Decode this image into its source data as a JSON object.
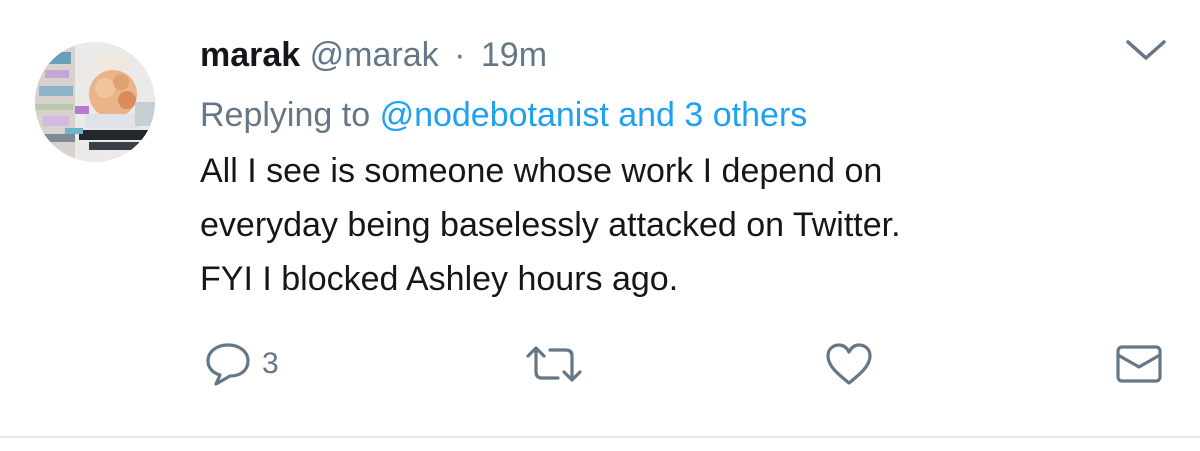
{
  "tweet": {
    "author": {
      "name": "marak",
      "handle": "@marak"
    },
    "separator": "·",
    "time": "19m",
    "replying_label": "Replying to",
    "replying_to": "@nodebotanist and 3 others",
    "body_lines": [
      "All I see is someone whose work I depend on",
      "everyday being baselessly attacked on Twitter.",
      "FYI I blocked Ashley hours ago."
    ],
    "actions": {
      "reply_icon": "reply-icon",
      "reply_count": "3",
      "retweet_icon": "retweet-icon",
      "like_icon": "heart-icon",
      "share_icon": "envelope-icon"
    },
    "menu_icon": "chevron-down-icon"
  },
  "colors": {
    "text": "#14171a",
    "secondary": "#657786",
    "link": "#1da1f2",
    "divider": "#e1e8ed"
  }
}
